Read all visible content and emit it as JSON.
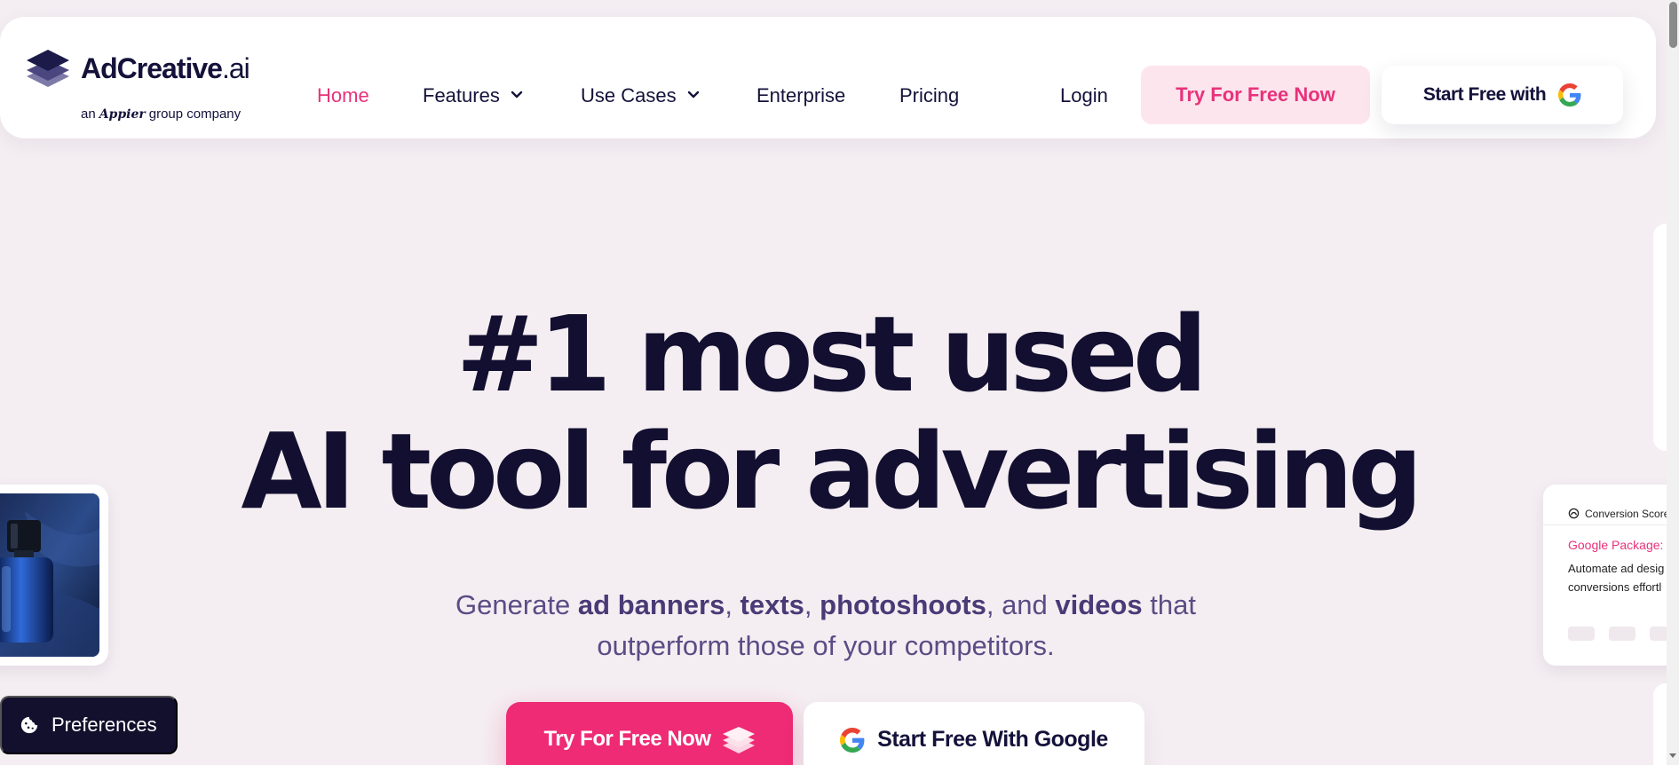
{
  "brand": {
    "name": "AdCreative",
    "suffix": ".ai",
    "tagline_prefix": "an",
    "tagline_partner": "Appier",
    "tagline_suffix": "group company"
  },
  "nav": {
    "items": [
      {
        "label": "Home",
        "active": true
      },
      {
        "label": "Features",
        "dropdown": true
      },
      {
        "label": "Use Cases",
        "dropdown": true
      },
      {
        "label": "Enterprise"
      },
      {
        "label": "Pricing"
      }
    ],
    "login": "Login",
    "try_free": "Try For Free Now",
    "start_free_google": "Start Free with"
  },
  "hero": {
    "line1": "#1 most used",
    "line2": "AI tool for advertising",
    "subtitle": {
      "p1": "Generate ",
      "b1": "ad banners",
      "p2": ", ",
      "b2": "texts",
      "p3": ", ",
      "b3": "photoshoots",
      "p4": ", and ",
      "b4": "videos",
      "p5": " that",
      "line2": "outperform those of your competitors."
    },
    "cta_primary": "Try For Free Now",
    "cta_google": "Start Free With Google"
  },
  "score_card": {
    "header": "Conversion Score",
    "title": "Google Package:",
    "text_line1": "Automate ad desig",
    "text_line2": "conversions effortl"
  },
  "preferences": {
    "label": "Preferences"
  },
  "colors": {
    "accent": "#e8327a",
    "cta_pink": "#ee2b74",
    "navy": "#14123a",
    "background": "#f4eef2"
  },
  "icons": {
    "logo": "stacked-layers-icon",
    "chevron": "chevron-down-icon",
    "google": "google-g-icon",
    "cookie": "cookie-icon",
    "stack": "layers-stack-icon"
  }
}
